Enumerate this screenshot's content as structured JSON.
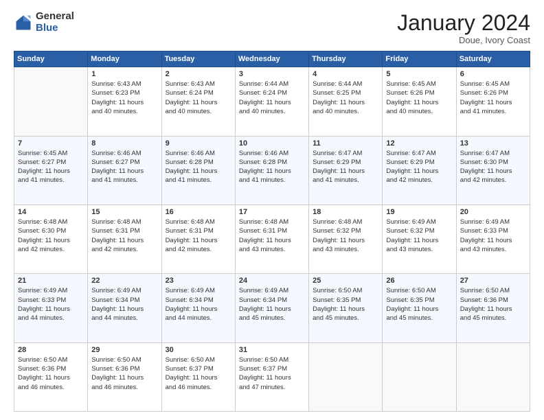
{
  "logo": {
    "general": "General",
    "blue": "Blue"
  },
  "title": "January 2024",
  "location": "Doue, Ivory Coast",
  "days_of_week": [
    "Sunday",
    "Monday",
    "Tuesday",
    "Wednesday",
    "Thursday",
    "Friday",
    "Saturday"
  ],
  "weeks": [
    [
      {
        "day": "",
        "info": ""
      },
      {
        "day": "1",
        "info": "Sunrise: 6:43 AM\nSunset: 6:23 PM\nDaylight: 11 hours\nand 40 minutes."
      },
      {
        "day": "2",
        "info": "Sunrise: 6:43 AM\nSunset: 6:24 PM\nDaylight: 11 hours\nand 40 minutes."
      },
      {
        "day": "3",
        "info": "Sunrise: 6:44 AM\nSunset: 6:24 PM\nDaylight: 11 hours\nand 40 minutes."
      },
      {
        "day": "4",
        "info": "Sunrise: 6:44 AM\nSunset: 6:25 PM\nDaylight: 11 hours\nand 40 minutes."
      },
      {
        "day": "5",
        "info": "Sunrise: 6:45 AM\nSunset: 6:26 PM\nDaylight: 11 hours\nand 40 minutes."
      },
      {
        "day": "6",
        "info": "Sunrise: 6:45 AM\nSunset: 6:26 PM\nDaylight: 11 hours\nand 41 minutes."
      }
    ],
    [
      {
        "day": "7",
        "info": "Sunrise: 6:45 AM\nSunset: 6:27 PM\nDaylight: 11 hours\nand 41 minutes."
      },
      {
        "day": "8",
        "info": "Sunrise: 6:46 AM\nSunset: 6:27 PM\nDaylight: 11 hours\nand 41 minutes."
      },
      {
        "day": "9",
        "info": "Sunrise: 6:46 AM\nSunset: 6:28 PM\nDaylight: 11 hours\nand 41 minutes."
      },
      {
        "day": "10",
        "info": "Sunrise: 6:46 AM\nSunset: 6:28 PM\nDaylight: 11 hours\nand 41 minutes."
      },
      {
        "day": "11",
        "info": "Sunrise: 6:47 AM\nSunset: 6:29 PM\nDaylight: 11 hours\nand 41 minutes."
      },
      {
        "day": "12",
        "info": "Sunrise: 6:47 AM\nSunset: 6:29 PM\nDaylight: 11 hours\nand 42 minutes."
      },
      {
        "day": "13",
        "info": "Sunrise: 6:47 AM\nSunset: 6:30 PM\nDaylight: 11 hours\nand 42 minutes."
      }
    ],
    [
      {
        "day": "14",
        "info": "Sunrise: 6:48 AM\nSunset: 6:30 PM\nDaylight: 11 hours\nand 42 minutes."
      },
      {
        "day": "15",
        "info": "Sunrise: 6:48 AM\nSunset: 6:31 PM\nDaylight: 11 hours\nand 42 minutes."
      },
      {
        "day": "16",
        "info": "Sunrise: 6:48 AM\nSunset: 6:31 PM\nDaylight: 11 hours\nand 42 minutes."
      },
      {
        "day": "17",
        "info": "Sunrise: 6:48 AM\nSunset: 6:31 PM\nDaylight: 11 hours\nand 43 minutes."
      },
      {
        "day": "18",
        "info": "Sunrise: 6:48 AM\nSunset: 6:32 PM\nDaylight: 11 hours\nand 43 minutes."
      },
      {
        "day": "19",
        "info": "Sunrise: 6:49 AM\nSunset: 6:32 PM\nDaylight: 11 hours\nand 43 minutes."
      },
      {
        "day": "20",
        "info": "Sunrise: 6:49 AM\nSunset: 6:33 PM\nDaylight: 11 hours\nand 43 minutes."
      }
    ],
    [
      {
        "day": "21",
        "info": "Sunrise: 6:49 AM\nSunset: 6:33 PM\nDaylight: 11 hours\nand 44 minutes."
      },
      {
        "day": "22",
        "info": "Sunrise: 6:49 AM\nSunset: 6:34 PM\nDaylight: 11 hours\nand 44 minutes."
      },
      {
        "day": "23",
        "info": "Sunrise: 6:49 AM\nSunset: 6:34 PM\nDaylight: 11 hours\nand 44 minutes."
      },
      {
        "day": "24",
        "info": "Sunrise: 6:49 AM\nSunset: 6:34 PM\nDaylight: 11 hours\nand 45 minutes."
      },
      {
        "day": "25",
        "info": "Sunrise: 6:50 AM\nSunset: 6:35 PM\nDaylight: 11 hours\nand 45 minutes."
      },
      {
        "day": "26",
        "info": "Sunrise: 6:50 AM\nSunset: 6:35 PM\nDaylight: 11 hours\nand 45 minutes."
      },
      {
        "day": "27",
        "info": "Sunrise: 6:50 AM\nSunset: 6:36 PM\nDaylight: 11 hours\nand 45 minutes."
      }
    ],
    [
      {
        "day": "28",
        "info": "Sunrise: 6:50 AM\nSunset: 6:36 PM\nDaylight: 11 hours\nand 46 minutes."
      },
      {
        "day": "29",
        "info": "Sunrise: 6:50 AM\nSunset: 6:36 PM\nDaylight: 11 hours\nand 46 minutes."
      },
      {
        "day": "30",
        "info": "Sunrise: 6:50 AM\nSunset: 6:37 PM\nDaylight: 11 hours\nand 46 minutes."
      },
      {
        "day": "31",
        "info": "Sunrise: 6:50 AM\nSunset: 6:37 PM\nDaylight: 11 hours\nand 47 minutes."
      },
      {
        "day": "",
        "info": ""
      },
      {
        "day": "",
        "info": ""
      },
      {
        "day": "",
        "info": ""
      }
    ]
  ]
}
